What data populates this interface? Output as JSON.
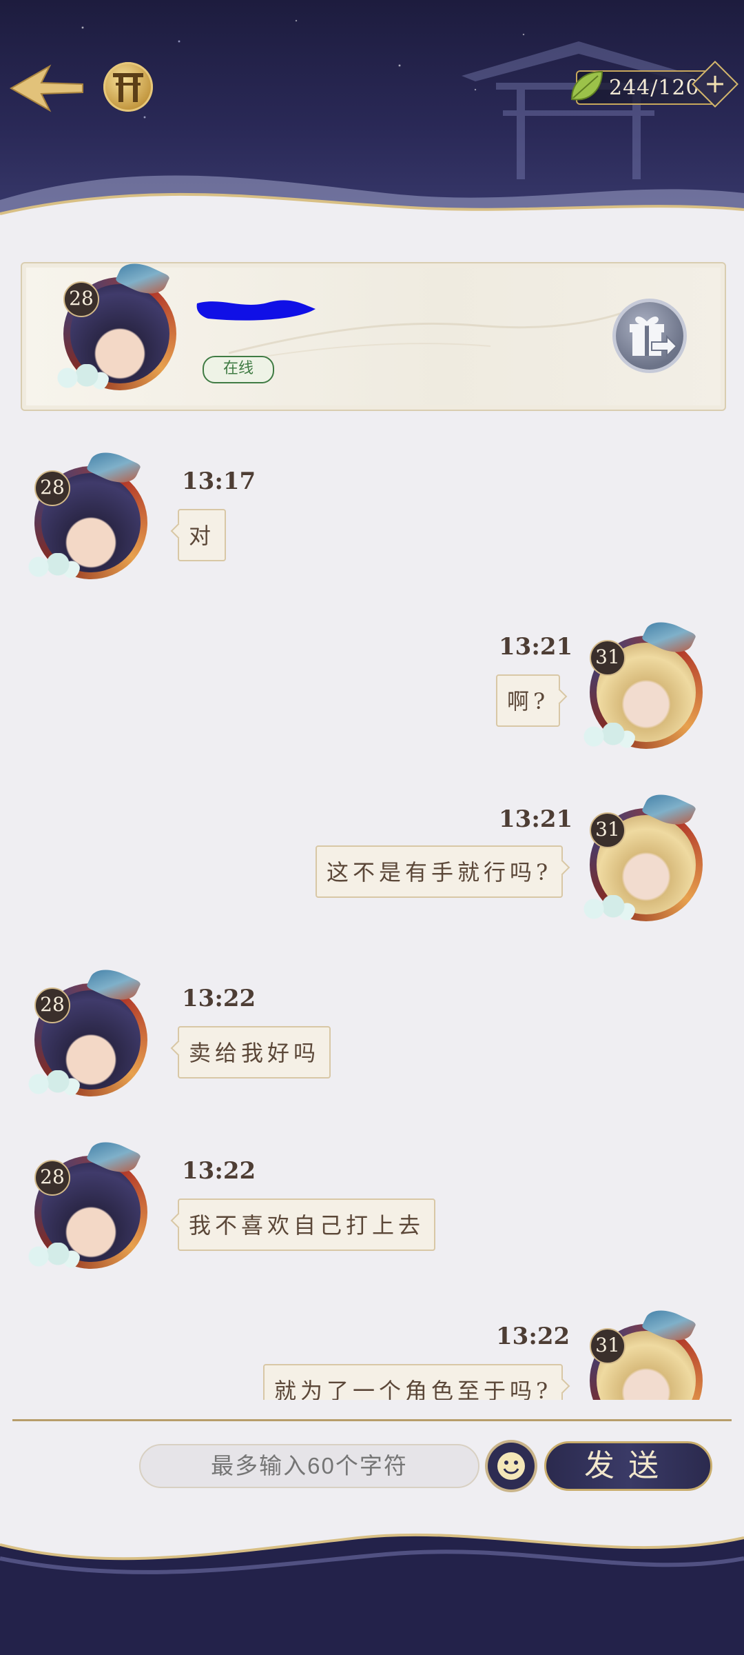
{
  "header": {
    "currency": {
      "value": "244/120",
      "icon": "leaf-icon",
      "plus_label": "+"
    }
  },
  "profile": {
    "level": "28",
    "status": "在线"
  },
  "messages": [
    {
      "side": "left",
      "level": "28",
      "time": "13:17",
      "text": "对"
    },
    {
      "side": "right",
      "level": "31",
      "time": "13:21",
      "text": "啊?"
    },
    {
      "side": "right",
      "level": "31",
      "time": "13:21",
      "text": "这不是有手就行吗?"
    },
    {
      "side": "left",
      "level": "28",
      "time": "13:22",
      "text": "卖给我好吗"
    },
    {
      "side": "left",
      "level": "28",
      "time": "13:22",
      "text": "我不喜欢自己打上去"
    },
    {
      "side": "right",
      "level": "31",
      "time": "13:22",
      "text": "就为了一个角色至于吗?"
    }
  ],
  "input": {
    "placeholder": "最多输入60个字符"
  },
  "send_label": "发送",
  "colors": {
    "accent_gold": "#c9ad6c",
    "night": "#23224a",
    "online_green": "#3f7b43"
  }
}
